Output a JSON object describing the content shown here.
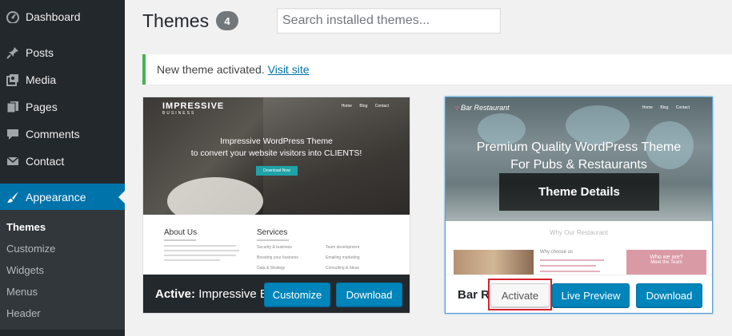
{
  "sidebar": {
    "items": [
      {
        "label": "Dashboard",
        "icon": "dashboard-icon"
      },
      {
        "label": "Posts",
        "icon": "pin-icon"
      },
      {
        "label": "Media",
        "icon": "media-icon"
      },
      {
        "label": "Pages",
        "icon": "pages-icon"
      },
      {
        "label": "Comments",
        "icon": "comment-icon"
      },
      {
        "label": "Contact",
        "icon": "mail-icon"
      },
      {
        "label": "Appearance",
        "icon": "paintbrush-icon",
        "current": true
      }
    ],
    "submenu": [
      {
        "label": "Themes",
        "current": true
      },
      {
        "label": "Customize"
      },
      {
        "label": "Widgets"
      },
      {
        "label": "Menus"
      },
      {
        "label": "Header"
      }
    ]
  },
  "header": {
    "title": "Themes",
    "count": "4",
    "search_placeholder": "Search installed themes..."
  },
  "notice": {
    "text": "New theme activated.",
    "link": "Visit site"
  },
  "themes": [
    {
      "active_prefix": "Active:",
      "name": "Impressive B",
      "buttons": {
        "customize": "Customize",
        "download": "Download"
      },
      "screenshot": {
        "logo": "IMPRESSIVE",
        "logo_sub": "BUSINESS",
        "nav": [
          "Home",
          "Blog",
          "Contact"
        ],
        "headline_1": "Impressive WordPress Theme",
        "headline_2": "to convert your website visitors into CLIENTS!",
        "cta": "Download Now",
        "section_1": "About Us",
        "section_2": "Services",
        "services": [
          "Security & business",
          "Boosting your business",
          "Data & Strategy",
          "Team development",
          "Emailing marketing",
          "Consulting & Ideas"
        ]
      }
    },
    {
      "name": "Bar R",
      "details_label": "Theme Details",
      "buttons": {
        "activate": "Activate",
        "live_preview": "Live Preview",
        "download": "Download"
      },
      "screenshot": {
        "logo": "Bar Restaurant",
        "nav": [
          "Home",
          "Blog",
          "Contact"
        ],
        "headline_1": "Premium Quality WordPress Theme",
        "headline_2": "For Pubs & Restaurants",
        "subheading": "Why Our Restaurant",
        "mid_title": "Why choose us",
        "pink_title": "Who we are?",
        "pink_sub": "Meet the Team"
      }
    }
  ],
  "colors": {
    "sidebar_bg": "#23282d",
    "accent": "#0073aa",
    "primary_button": "#0085ba",
    "notice_border": "#46b450",
    "highlight": "#d6222a"
  }
}
